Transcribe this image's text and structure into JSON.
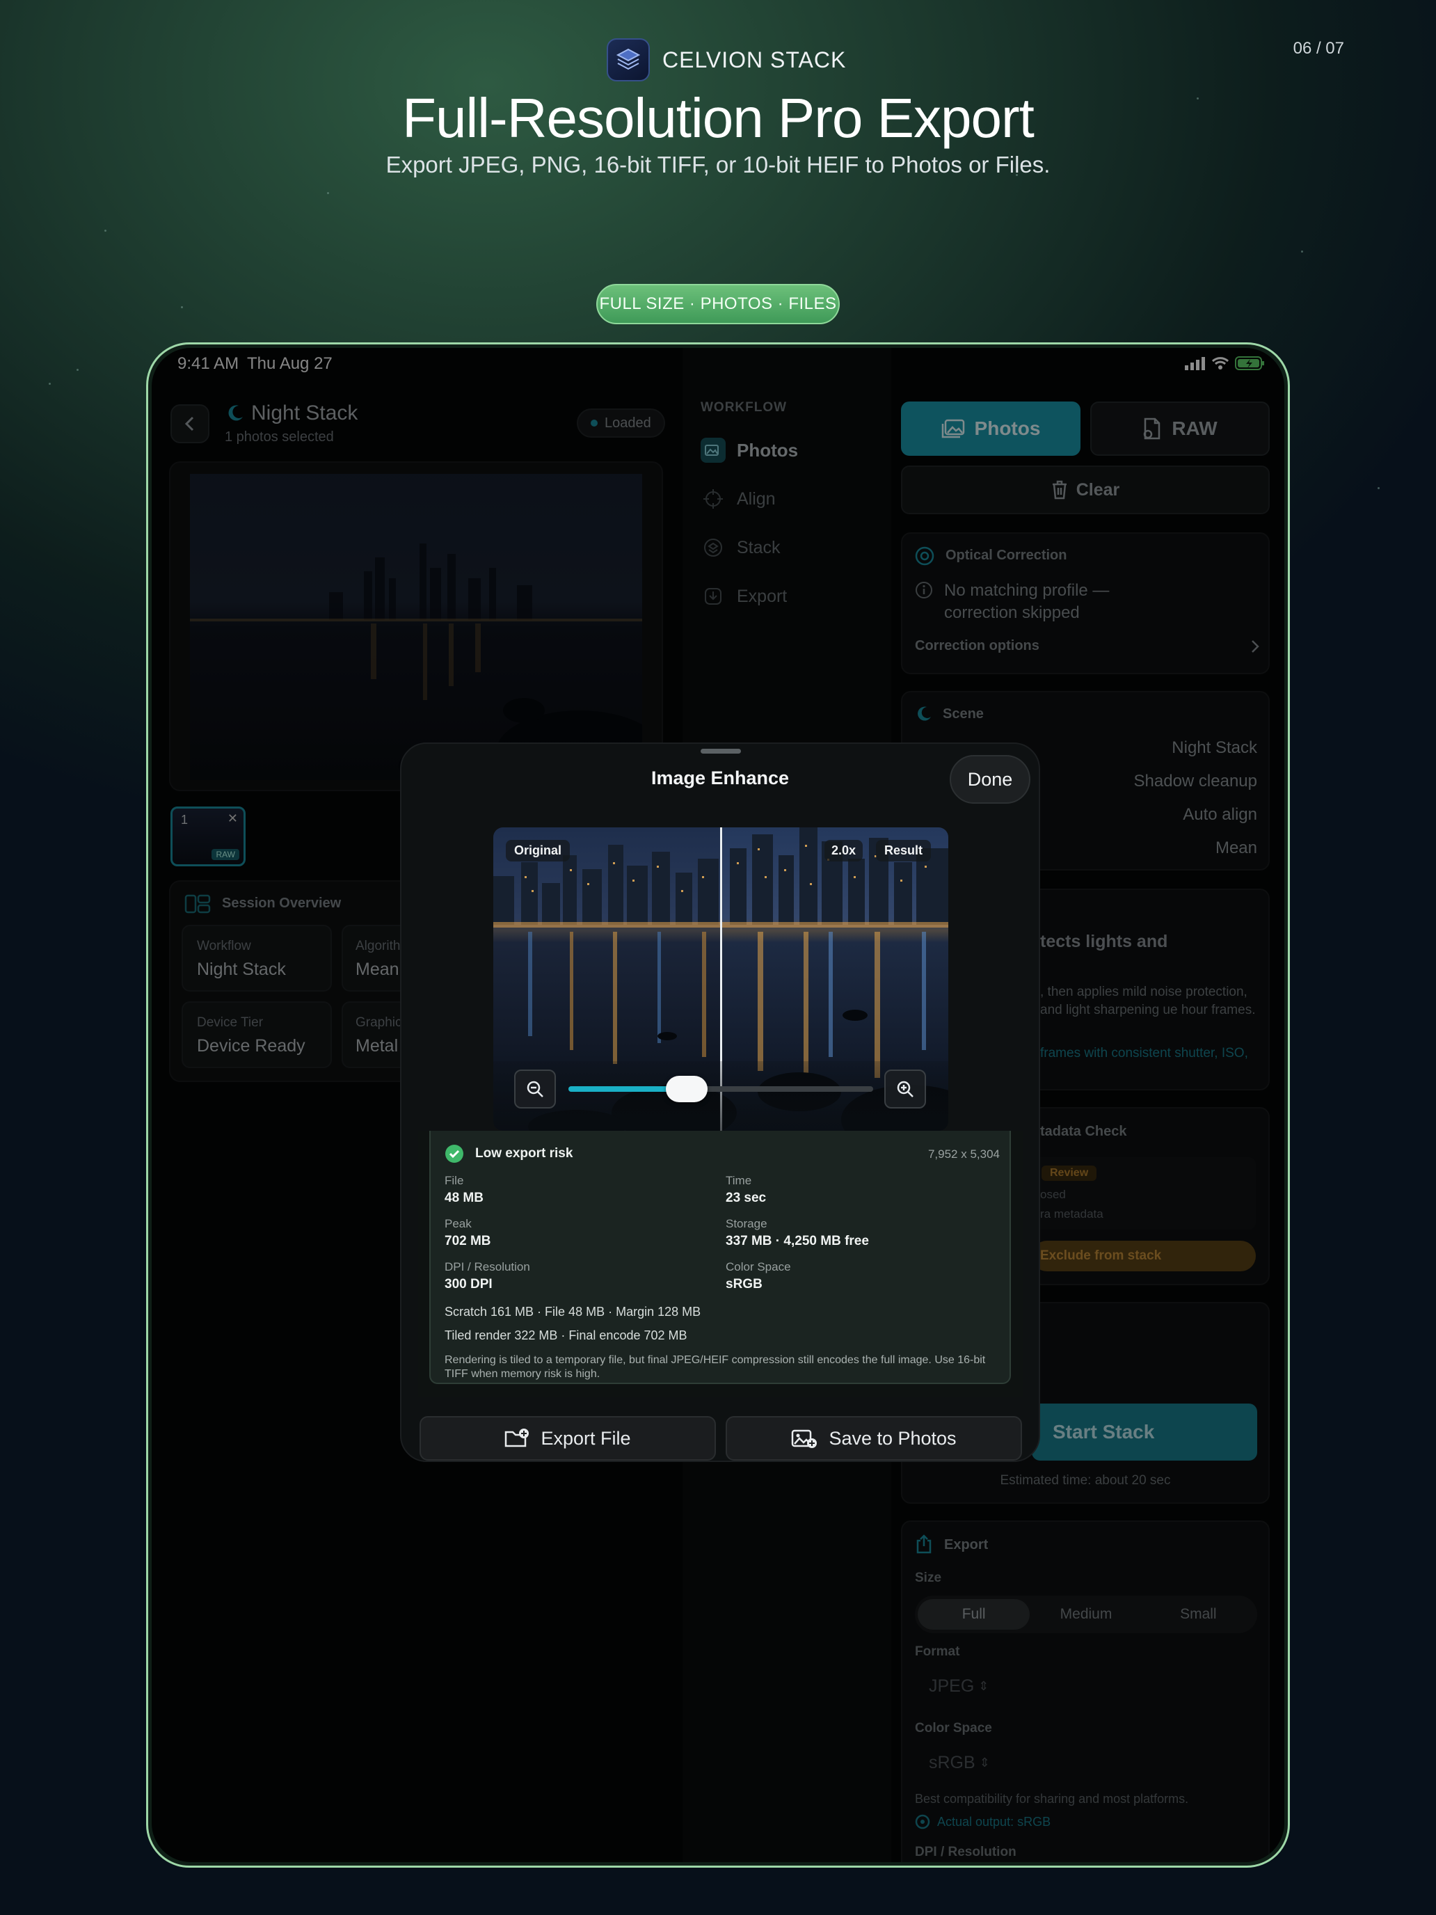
{
  "header": {
    "brand": "CELVION STACK",
    "page_counter": "06 / 07",
    "headline": "Full-Resolution Pro Export",
    "subhead": "Export JPEG, PNG, 16-bit TIFF, or 10-bit HEIF to Photos or Files.",
    "pill": "FULL SIZE · PHOTOS · FILES"
  },
  "status_bar": {
    "time": "9:41 AM",
    "date": "Thu Aug 27"
  },
  "left": {
    "title": "Night Stack",
    "subtitle": "1 photos selected",
    "loaded_badge": "Loaded",
    "thumb_index": "1",
    "thumb_badge": "RAW",
    "session_title": "Session Overview",
    "tiles": [
      {
        "label": "Workflow",
        "value": "Night Stack"
      },
      {
        "label": "Algorith",
        "value": "Mean"
      },
      {
        "label": "Device Tier",
        "value": "Device Ready"
      },
      {
        "label": "Graphic",
        "value": "Metal"
      }
    ]
  },
  "workflow": {
    "heading": "WORKFLOW",
    "items": [
      "Photos",
      "Align",
      "Stack",
      "Export"
    ]
  },
  "right": {
    "photos_btn": "Photos",
    "raw_btn": "RAW",
    "clear_btn": "Clear",
    "optical_title": "Optical Correction",
    "optical_msg": "No matching profile — correction skipped",
    "correction_options": "Correction options",
    "scene_title": "Scene",
    "scene_rows": [
      "Night Stack",
      "Shadow cleanup",
      "Auto align",
      "Mean"
    ],
    "desc_title": "tects lights and",
    "desc_body": ", then applies mild noise protection, and light sharpening ue hour frames.",
    "desc_link": "frames with consistent shutter, ISO,",
    "metadata_title": "tadata Check",
    "review_badge": "Review",
    "meta_line1": "osed",
    "meta_line2": "ra metadata",
    "exclude_btn": "Exclude from stack",
    "start_btn": "Start Stack",
    "estimate": "Estimated time: about 20 sec",
    "export_title": "Export",
    "size_label": "Size",
    "size_options": [
      "Full",
      "Medium",
      "Small"
    ],
    "format_label": "Format",
    "format_value": "JPEG",
    "colorspace_label": "Color Space",
    "colorspace_value": "sRGB",
    "compat_note": "Best compatibility for sharing and most platforms.",
    "actual_output": "Actual output: sRGB",
    "dpi_label": "DPI / Resolution"
  },
  "sheet": {
    "title": "Image Enhance",
    "done": "Done",
    "original_label": "Original",
    "zoom_label": "2.0x",
    "result_label": "Result",
    "zoom_slider": 0.36,
    "risk_label": "Low export risk",
    "dimensions": "7,952 x 5,304",
    "stats": [
      {
        "label": "File",
        "value": "48 MB"
      },
      {
        "label": "Time",
        "value": "23 sec"
      },
      {
        "label": "Peak",
        "value": "702 MB"
      },
      {
        "label": "Storage",
        "value": "337 MB · 4,250 MB free"
      },
      {
        "label": "DPI / Resolution",
        "value": "300 DPI"
      },
      {
        "label": "Color Space",
        "value": "sRGB"
      }
    ],
    "mem_line1": "Scratch 161 MB · File 48 MB · Margin 128 MB",
    "mem_line2": "Tiled render 322 MB · Final encode 702 MB",
    "note": "Rendering is tiled to a temporary file, but final JPEG/HEIF compression still encodes the full image. Use 16-bit TIFF when memory risk is high.",
    "export_file_btn": "Export File",
    "save_photos_btn": "Save to Photos"
  },
  "colors": {
    "accent": "#1aa3b8",
    "pill_green": "#4fae66",
    "risk_green": "#3fb86a",
    "review_orange": "#c98a2c"
  }
}
